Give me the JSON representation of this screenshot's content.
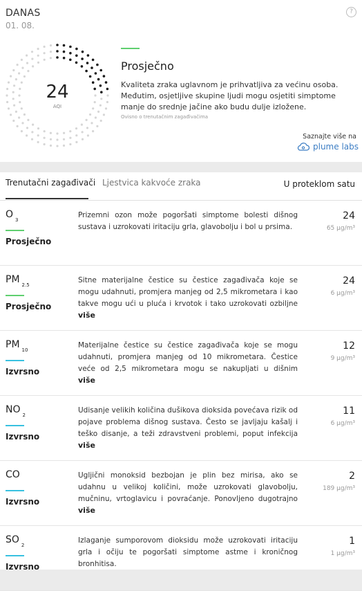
{
  "header": {
    "title": "DANAS",
    "date": "01. 08.",
    "help_glyph": "?"
  },
  "aqi": {
    "value": "24",
    "unit": "AQI",
    "level": 0.24,
    "status": "Prosječno",
    "status_color": "#5fcf6f",
    "description": "Kvaliteta zraka uglavnom je prihvatljiva za većinu osoba. Međutim, osjetljive skupine ljudi mogu osjetiti simptome manje do srednje jačine ako budu dulje izložene.",
    "note": "Ovisno o trenutačnim zagađivačima"
  },
  "brand": {
    "learn_more": "Saznajte više na",
    "name": "plume labs",
    "color": "#3d7ec4"
  },
  "tabs": {
    "current": "Trenutačni zagađivači",
    "scale": "Ljestvica kakvoće zraka",
    "period": "U proteklom satu"
  },
  "pollutants": [
    {
      "name": "O",
      "sub": "3",
      "status": "Prosječno",
      "color": "#5fcf6f",
      "description": "Prizemni ozon može pogoršati simptome bolesti dišnog sustava i uzrokovati iritaciju grla, glavobolju i bol u prsima.",
      "more": "",
      "value": "24",
      "unit": "65 µg/m³"
    },
    {
      "name": "PM",
      "sub": "2.5",
      "status": "Prosječno",
      "color": "#5fcf6f",
      "description": "Sitne materijalne čestice su čestice zagađivača koje se mogu udahnuti, promjera manjeg od 2,5 mikrometara i kao takve mogu ući u pluća i krvotok i tako uzrokovati ozbiljne zdravstvene probleme.",
      "more": "više",
      "value": "24",
      "unit": "6 µg/m³"
    },
    {
      "name": "PM",
      "sub": "10",
      "status": "Izvrsno",
      "color": "#38c1e0",
      "description": "Materijalne čestice su čestice zagađivača koje se mogu udahnuti, promjera manjeg od 10 mikrometara. Čestice veće od 2,5 mikrometara mogu se nakupljati u dišnim putovima, što je uzrok zdravstvenih problema.",
      "more": "više",
      "value": "12",
      "unit": "9 µg/m³"
    },
    {
      "name": "NO",
      "sub": "2",
      "status": "Izvrsno",
      "color": "#38c1e0",
      "description": "Udisanje velikih količina dušikova dioksida povećava rizik od pojave problema dišnog sustava. Često se javljaju kašalj i teško disanje, a teži zdravstveni problemi, poput infekcija dišnog sustava, javljaju se pri duljem izlaganju.",
      "more": "više",
      "value": "11",
      "unit": "6 µg/m³"
    },
    {
      "name": "CO",
      "sub": "",
      "status": "Izvrsno",
      "color": "#38c1e0",
      "description": "Ugljični monoksid bezbojan je plin bez mirisa, ako se udahnu u velikoj količini, može uzrokovati glavobolju, mučninu, vrtoglavicu i povraćanje. Ponovljeno dugotrajno izlaganje može uzrokovati srčane bolesti.",
      "more": "više",
      "value": "2",
      "unit": "189 µg/m³"
    },
    {
      "name": "SO",
      "sub": "2",
      "status": "Izvrsno",
      "color": "#38c1e0",
      "description": "Izlaganje sumporovom dioksidu može uzrokovati iritaciju grla i očiju te pogoršati simptome astme i kroničnog bronhitisa.",
      "more": "",
      "value": "1",
      "unit": "1 µg/m³"
    }
  ]
}
